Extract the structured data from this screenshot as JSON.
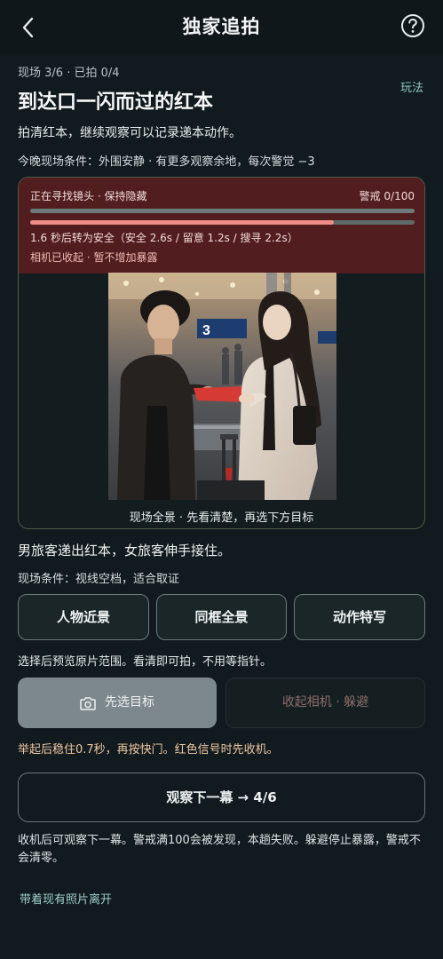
{
  "header": {
    "title": "独家追拍",
    "back_icon": "chevron-left-icon",
    "help_icon": "question-circle-icon"
  },
  "progress": {
    "scene": "现场 3/6",
    "separator": "·",
    "shot": "已拍 0/4"
  },
  "rules_label": "玩法",
  "scene": {
    "title": "到达口一闪而过的红本",
    "description": "拍清红本，继续观察可以记录递本动作。",
    "conditions": "今晚现场条件：外围安静 · 有更多观察余地，每次警觉 −3"
  },
  "alert": {
    "status": "正在寻找镜头 · 保持隐藏",
    "level_label": "警戒 0/100",
    "alert_level": 0,
    "safe_progress": 0.79,
    "timer": "1.6 秒后转为安全（安全 2.6s / 留意 1.2s / 搜寻 2.2s）",
    "camera_status": "相机已收起 · 暂不增加暴露",
    "color": "#511d1f",
    "accent": "#ef8d89"
  },
  "photo_caption": "现场全景 · 先看清楚，再选下方目标",
  "action": {
    "description": "男旅客递出红本，女旅客伸手接住。",
    "conditions": "现场条件：视线空档，适合取证"
  },
  "targets": [
    "人物近景",
    "同框全景",
    "动作特写"
  ],
  "preview_hint": "选择后预览原片范围。看清即可拍，不用等指针。",
  "shoot_button": {
    "label": "先选目标",
    "icon": "camera-icon"
  },
  "hide_button": "收起相机 · 躲避",
  "stabilize_hint": "举起后稳住0.7秒，再按快门。红色信号时先收机。",
  "next_button": "观察下一幕 → 4/6",
  "rule_text": "收机后可观察下一幕。警戒满100会被发现，本趟失败。躲避停止暴露，警戒不会清零。",
  "leave_link": "带着现有照片离开"
}
